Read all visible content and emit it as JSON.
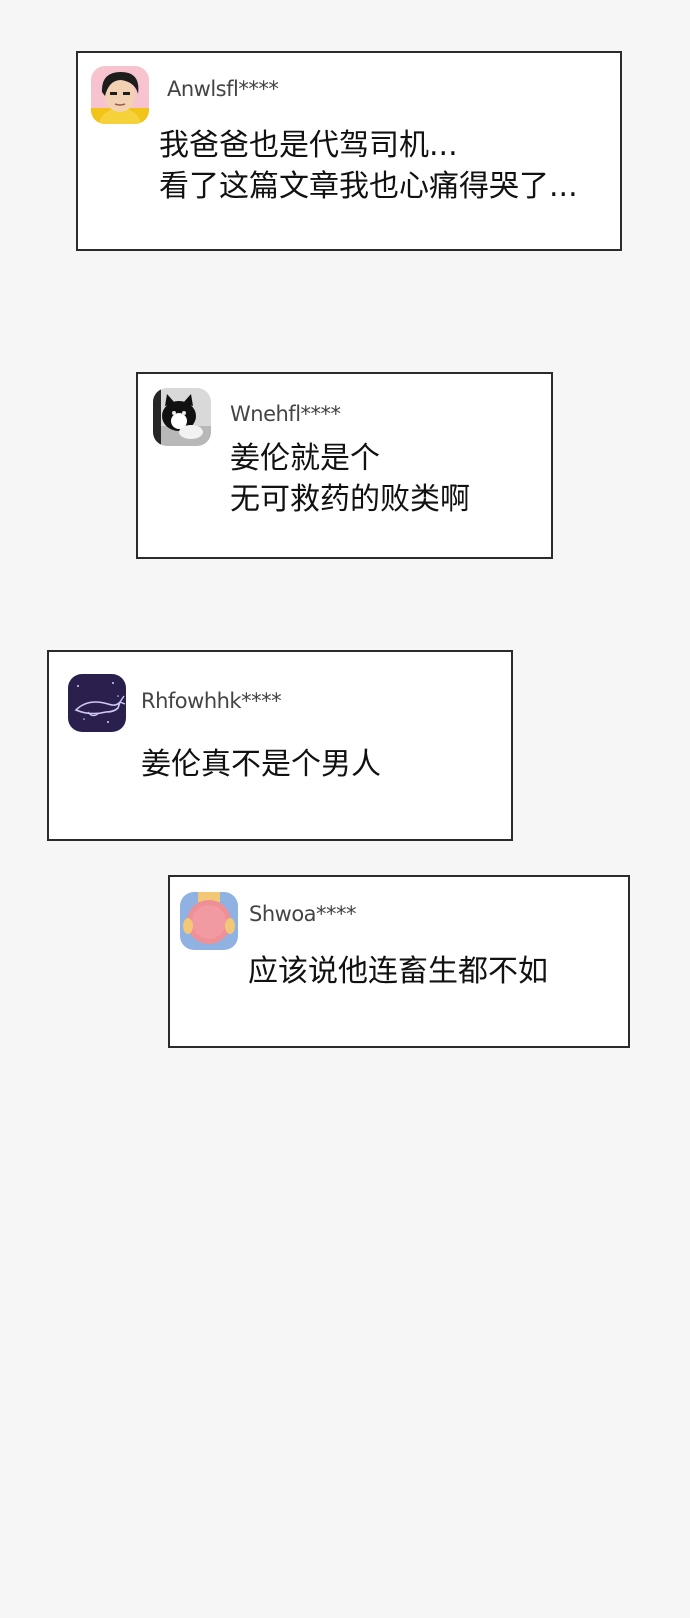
{
  "background_color": "#f6f6f6",
  "card_border_color": "#2b2b2b",
  "comments": [
    {
      "username": "Anwlsfl****",
      "avatar_icon": "cartoon-boy-avatar-icon",
      "lines": [
        "我爸爸也是代驾司机...",
        "看了这篇文章我也心痛得哭了..."
      ]
    },
    {
      "username": "Wnehfl****",
      "avatar_icon": "black-white-cat-avatar-icon",
      "lines": [
        "姜伦就是个",
        "无可救药的败类啊"
      ]
    },
    {
      "username": "Rhfowhhk****",
      "avatar_icon": "whale-avatar-icon",
      "lines": [
        "姜伦真不是个男人"
      ]
    },
    {
      "username": "Shwoa****",
      "avatar_icon": "pink-character-avatar-icon",
      "lines": [
        "应该说他连畜生都不如"
      ]
    }
  ]
}
